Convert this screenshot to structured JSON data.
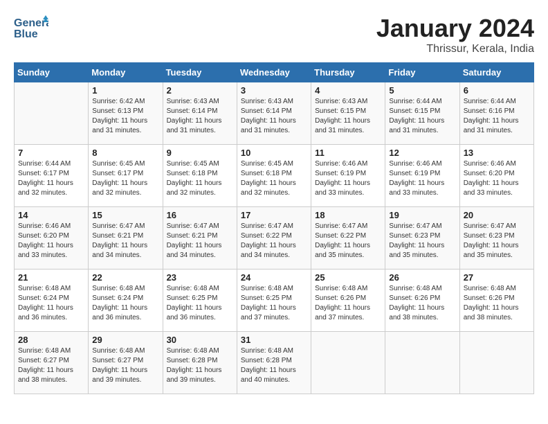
{
  "header": {
    "logo_line1": "General",
    "logo_line2": "Blue",
    "month_year": "January 2024",
    "location": "Thrissur, Kerala, India"
  },
  "columns": [
    "Sunday",
    "Monday",
    "Tuesday",
    "Wednesday",
    "Thursday",
    "Friday",
    "Saturday"
  ],
  "weeks": [
    [
      {
        "day": "",
        "sunrise": "",
        "sunset": "",
        "daylight": ""
      },
      {
        "day": "1",
        "sunrise": "Sunrise: 6:42 AM",
        "sunset": "Sunset: 6:13 PM",
        "daylight": "Daylight: 11 hours and 31 minutes."
      },
      {
        "day": "2",
        "sunrise": "Sunrise: 6:43 AM",
        "sunset": "Sunset: 6:14 PM",
        "daylight": "Daylight: 11 hours and 31 minutes."
      },
      {
        "day": "3",
        "sunrise": "Sunrise: 6:43 AM",
        "sunset": "Sunset: 6:14 PM",
        "daylight": "Daylight: 11 hours and 31 minutes."
      },
      {
        "day": "4",
        "sunrise": "Sunrise: 6:43 AM",
        "sunset": "Sunset: 6:15 PM",
        "daylight": "Daylight: 11 hours and 31 minutes."
      },
      {
        "day": "5",
        "sunrise": "Sunrise: 6:44 AM",
        "sunset": "Sunset: 6:15 PM",
        "daylight": "Daylight: 11 hours and 31 minutes."
      },
      {
        "day": "6",
        "sunrise": "Sunrise: 6:44 AM",
        "sunset": "Sunset: 6:16 PM",
        "daylight": "Daylight: 11 hours and 31 minutes."
      }
    ],
    [
      {
        "day": "7",
        "sunrise": "Sunrise: 6:44 AM",
        "sunset": "Sunset: 6:17 PM",
        "daylight": "Daylight: 11 hours and 32 minutes."
      },
      {
        "day": "8",
        "sunrise": "Sunrise: 6:45 AM",
        "sunset": "Sunset: 6:17 PM",
        "daylight": "Daylight: 11 hours and 32 minutes."
      },
      {
        "day": "9",
        "sunrise": "Sunrise: 6:45 AM",
        "sunset": "Sunset: 6:18 PM",
        "daylight": "Daylight: 11 hours and 32 minutes."
      },
      {
        "day": "10",
        "sunrise": "Sunrise: 6:45 AM",
        "sunset": "Sunset: 6:18 PM",
        "daylight": "Daylight: 11 hours and 32 minutes."
      },
      {
        "day": "11",
        "sunrise": "Sunrise: 6:46 AM",
        "sunset": "Sunset: 6:19 PM",
        "daylight": "Daylight: 11 hours and 33 minutes."
      },
      {
        "day": "12",
        "sunrise": "Sunrise: 6:46 AM",
        "sunset": "Sunset: 6:19 PM",
        "daylight": "Daylight: 11 hours and 33 minutes."
      },
      {
        "day": "13",
        "sunrise": "Sunrise: 6:46 AM",
        "sunset": "Sunset: 6:20 PM",
        "daylight": "Daylight: 11 hours and 33 minutes."
      }
    ],
    [
      {
        "day": "14",
        "sunrise": "Sunrise: 6:46 AM",
        "sunset": "Sunset: 6:20 PM",
        "daylight": "Daylight: 11 hours and 33 minutes."
      },
      {
        "day": "15",
        "sunrise": "Sunrise: 6:47 AM",
        "sunset": "Sunset: 6:21 PM",
        "daylight": "Daylight: 11 hours and 34 minutes."
      },
      {
        "day": "16",
        "sunrise": "Sunrise: 6:47 AM",
        "sunset": "Sunset: 6:21 PM",
        "daylight": "Daylight: 11 hours and 34 minutes."
      },
      {
        "day": "17",
        "sunrise": "Sunrise: 6:47 AM",
        "sunset": "Sunset: 6:22 PM",
        "daylight": "Daylight: 11 hours and 34 minutes."
      },
      {
        "day": "18",
        "sunrise": "Sunrise: 6:47 AM",
        "sunset": "Sunset: 6:22 PM",
        "daylight": "Daylight: 11 hours and 35 minutes."
      },
      {
        "day": "19",
        "sunrise": "Sunrise: 6:47 AM",
        "sunset": "Sunset: 6:23 PM",
        "daylight": "Daylight: 11 hours and 35 minutes."
      },
      {
        "day": "20",
        "sunrise": "Sunrise: 6:47 AM",
        "sunset": "Sunset: 6:23 PM",
        "daylight": "Daylight: 11 hours and 35 minutes."
      }
    ],
    [
      {
        "day": "21",
        "sunrise": "Sunrise: 6:48 AM",
        "sunset": "Sunset: 6:24 PM",
        "daylight": "Daylight: 11 hours and 36 minutes."
      },
      {
        "day": "22",
        "sunrise": "Sunrise: 6:48 AM",
        "sunset": "Sunset: 6:24 PM",
        "daylight": "Daylight: 11 hours and 36 minutes."
      },
      {
        "day": "23",
        "sunrise": "Sunrise: 6:48 AM",
        "sunset": "Sunset: 6:25 PM",
        "daylight": "Daylight: 11 hours and 36 minutes."
      },
      {
        "day": "24",
        "sunrise": "Sunrise: 6:48 AM",
        "sunset": "Sunset: 6:25 PM",
        "daylight": "Daylight: 11 hours and 37 minutes."
      },
      {
        "day": "25",
        "sunrise": "Sunrise: 6:48 AM",
        "sunset": "Sunset: 6:26 PM",
        "daylight": "Daylight: 11 hours and 37 minutes."
      },
      {
        "day": "26",
        "sunrise": "Sunrise: 6:48 AM",
        "sunset": "Sunset: 6:26 PM",
        "daylight": "Daylight: 11 hours and 38 minutes."
      },
      {
        "day": "27",
        "sunrise": "Sunrise: 6:48 AM",
        "sunset": "Sunset: 6:26 PM",
        "daylight": "Daylight: 11 hours and 38 minutes."
      }
    ],
    [
      {
        "day": "28",
        "sunrise": "Sunrise: 6:48 AM",
        "sunset": "Sunset: 6:27 PM",
        "daylight": "Daylight: 11 hours and 38 minutes."
      },
      {
        "day": "29",
        "sunrise": "Sunrise: 6:48 AM",
        "sunset": "Sunset: 6:27 PM",
        "daylight": "Daylight: 11 hours and 39 minutes."
      },
      {
        "day": "30",
        "sunrise": "Sunrise: 6:48 AM",
        "sunset": "Sunset: 6:28 PM",
        "daylight": "Daylight: 11 hours and 39 minutes."
      },
      {
        "day": "31",
        "sunrise": "Sunrise: 6:48 AM",
        "sunset": "Sunset: 6:28 PM",
        "daylight": "Daylight: 11 hours and 40 minutes."
      },
      {
        "day": "",
        "sunrise": "",
        "sunset": "",
        "daylight": ""
      },
      {
        "day": "",
        "sunrise": "",
        "sunset": "",
        "daylight": ""
      },
      {
        "day": "",
        "sunrise": "",
        "sunset": "",
        "daylight": ""
      }
    ]
  ]
}
